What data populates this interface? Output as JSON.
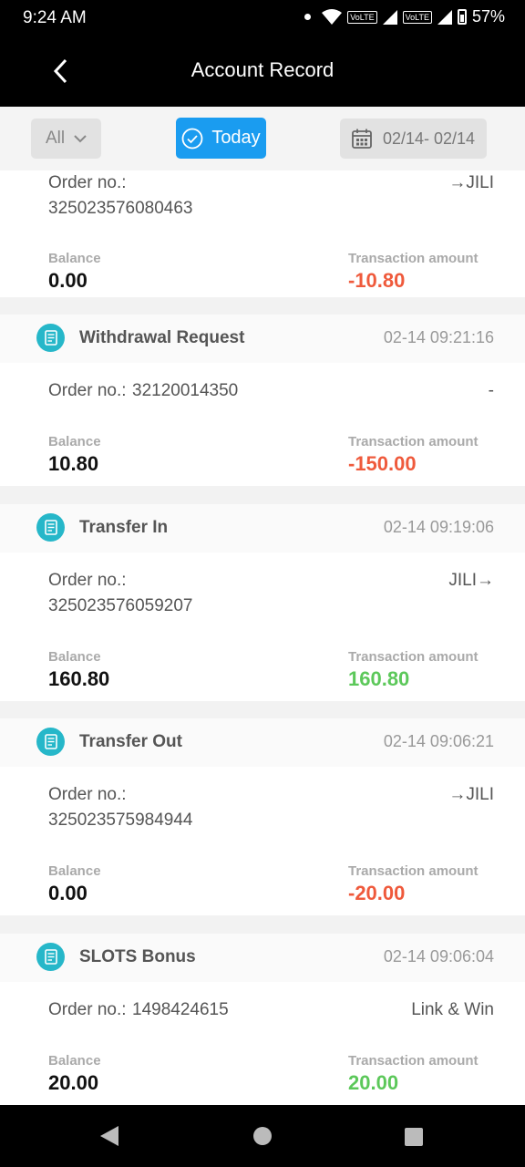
{
  "status_bar": {
    "time": "9:24 AM",
    "battery": "57%",
    "volte_1": "VoLTE",
    "volte_2": "VoLTE"
  },
  "app_bar": {
    "title": "Account Record"
  },
  "filters": {
    "type_selected": "All",
    "today_label": "Today",
    "date_range": "02/14- 02/14"
  },
  "labels": {
    "order_prefix": "Order no.:",
    "balance": "Balance",
    "amount": "Transaction amount"
  },
  "records": [
    {
      "order_no": "325023576080463",
      "note": "→JILI",
      "balance": "0.00",
      "amount": "-10.80"
    },
    {
      "type": "Withdrawal Request",
      "time": "02-14 09:21:16",
      "order_no": "32120014350",
      "note": "-",
      "balance": "10.80",
      "amount": "-150.00"
    },
    {
      "type": "Transfer In",
      "time": "02-14 09:19:06",
      "order_no": "325023576059207",
      "note": "JILI→",
      "balance": "160.80",
      "amount": "160.80"
    },
    {
      "type": "Transfer Out",
      "time": "02-14 09:06:21",
      "order_no": "325023575984944",
      "note": "→JILI",
      "balance": "0.00",
      "amount": "-20.00"
    },
    {
      "type": "SLOTS Bonus",
      "time": "02-14 09:06:04",
      "order_no": "1498424615",
      "note": "Link & Win",
      "balance": "20.00",
      "amount": "20.00"
    }
  ],
  "colors": {
    "accent": "#1a9cf0",
    "negative": "#ef5a3c",
    "positive": "#5cc85a",
    "icon_teal": "#26b7c9"
  },
  "icons": {
    "back": "chevron-left-icon",
    "dropdown": "chevron-down-icon",
    "today": "check-circle-icon",
    "date": "calendar-icon",
    "record": "receipt-icon"
  }
}
